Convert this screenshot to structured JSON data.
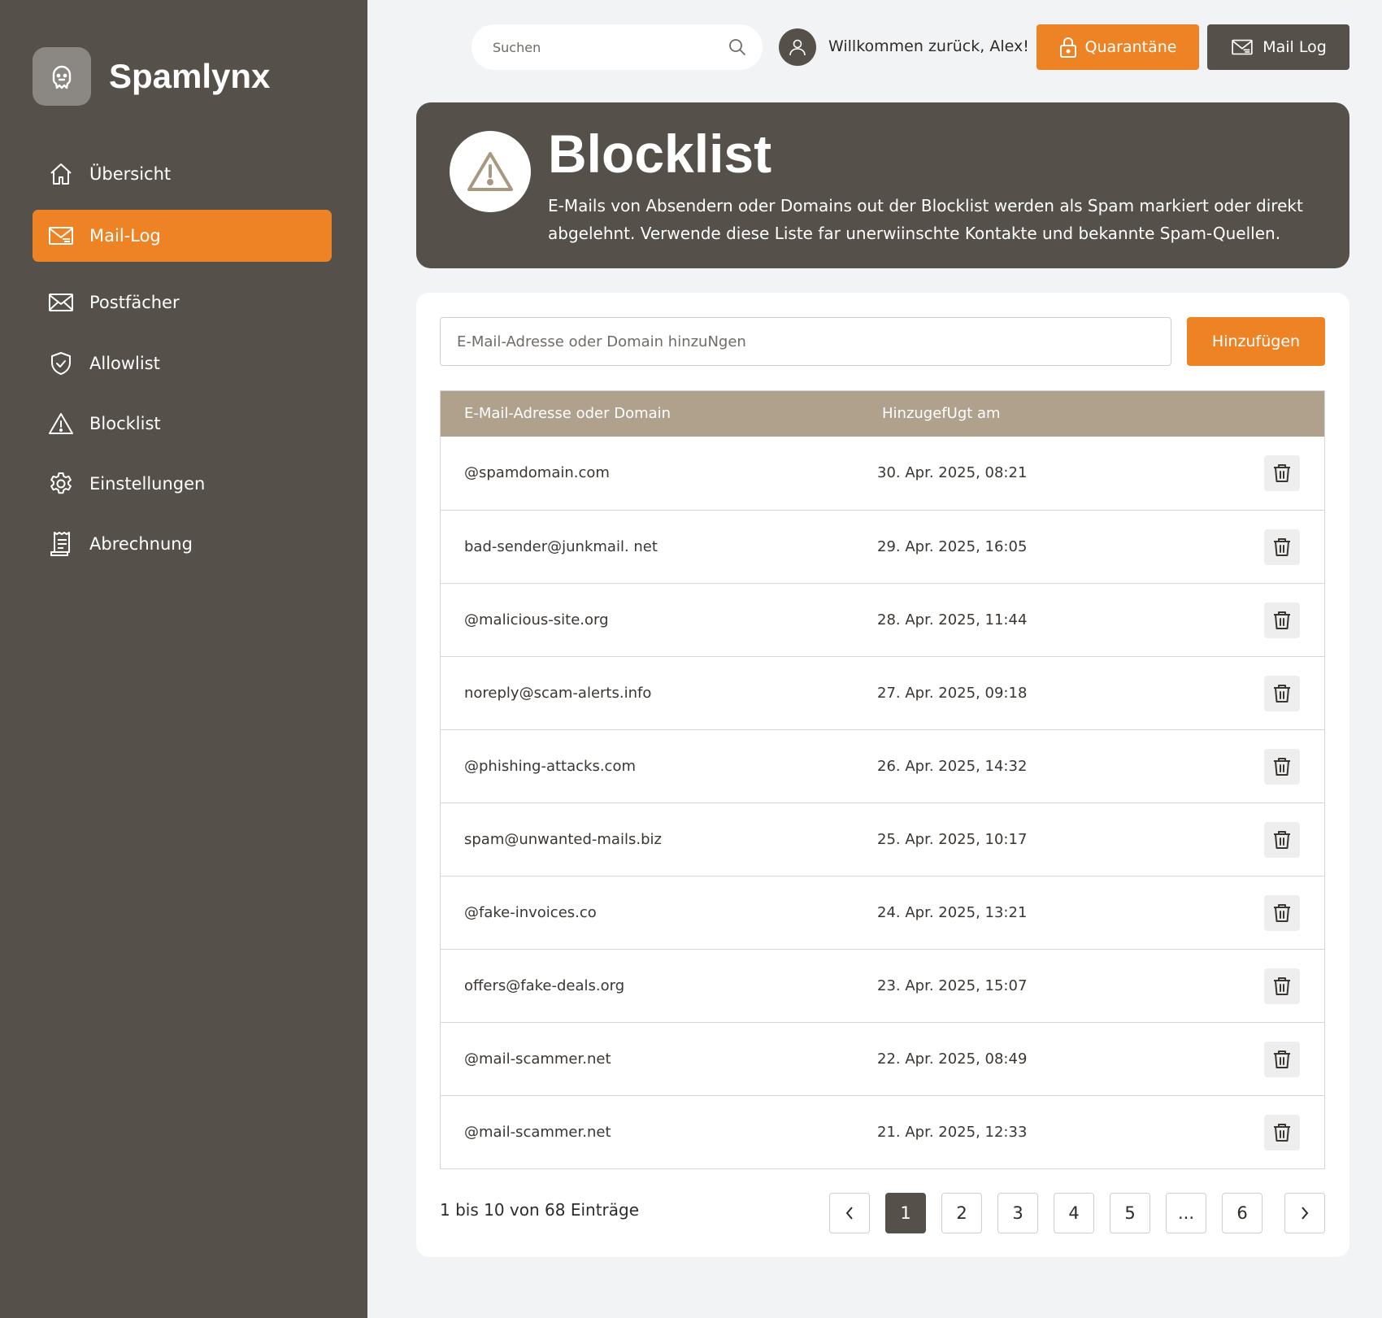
{
  "app": {
    "name": "Spamlynx"
  },
  "sidebar": {
    "items": [
      {
        "label": "Übersicht",
        "icon": "home-icon"
      },
      {
        "label": "Mail-Log",
        "icon": "mail-log-icon",
        "active": true
      },
      {
        "label": "Postfächer",
        "icon": "mailbox-icon"
      },
      {
        "label": "Allowlist",
        "icon": "shield-check-icon"
      },
      {
        "label": "Blocklist",
        "icon": "warning-triangle-icon"
      },
      {
        "label": "Einstellungen",
        "icon": "gear-icon"
      },
      {
        "label": "Abrechnung",
        "icon": "receipt-icon"
      }
    ]
  },
  "topbar": {
    "search_placeholder": "Suchen",
    "welcome": "Willkommen zurück, Alex!",
    "quarantine_label": "Quarantäne",
    "maillog_label": "Mail Log"
  },
  "hero": {
    "title": "Blocklist",
    "description": "E-Mails von Absendern oder Domains out der Blocklist werden als Spam markiert oder direkt abgelehnt. Verwende diese Liste far unerwiinschte Kontakte und bekannte Spam-Quellen."
  },
  "add": {
    "placeholder": "E-Mail-Adresse oder Domain hinzuNgen",
    "button": "Hinzufügen"
  },
  "table": {
    "headers": [
      "E-Mail-Adresse oder Domain",
      "HinzugefUgt am"
    ],
    "rows": [
      {
        "address": "@spamdomain.com",
        "date": "30. Apr. 2025, 08:21"
      },
      {
        "address": "bad-sender@junkmail. net",
        "date": "29. Apr. 2025, 16:05"
      },
      {
        "address": "@malicious-site.org",
        "date": "28. Apr. 2025, 11:44"
      },
      {
        "address": "noreply@scam-alerts.info",
        "date": "27. Apr. 2025, 09:18"
      },
      {
        "address": "@phishing-attacks.com",
        "date": "26. Apr. 2025, 14:32"
      },
      {
        "address": "spam@unwanted-mails.biz",
        "date": "25. Apr. 2025, 10:17"
      },
      {
        "address": "@fake-invoices.co",
        "date": "24. Apr. 2025, 13:21"
      },
      {
        "address": "offers@fake-deals.org",
        "date": "23. Apr. 2025, 15:07"
      },
      {
        "address": "@mail-scammer.net",
        "date": "22. Apr. 2025, 08:49"
      },
      {
        "address": "@mail-scammer.net",
        "date": "21. Apr. 2025, 12:33"
      }
    ]
  },
  "pagination": {
    "summary": "1 bis 10 von 68 Einträge",
    "pages": [
      "1",
      "2",
      "3",
      "4",
      "5",
      "...",
      "6"
    ],
    "current": "1"
  },
  "colors": {
    "accent": "#ee8326",
    "sidebar": "#55514a",
    "table_header": "#b0a18d",
    "background": "#f2f3f5"
  }
}
